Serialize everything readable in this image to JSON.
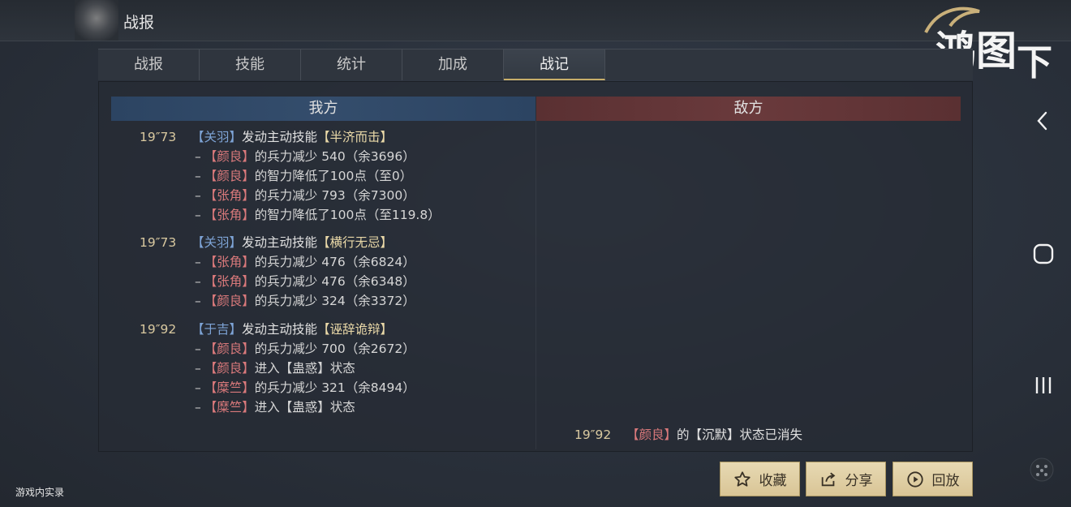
{
  "header": {
    "title": "战报"
  },
  "logo": {
    "text": "鸿图之下"
  },
  "tabs": [
    {
      "label": "战报"
    },
    {
      "label": "技能"
    },
    {
      "label": "统计"
    },
    {
      "label": "加成"
    },
    {
      "label": "战记"
    }
  ],
  "sides": {
    "ours": "我方",
    "enemy": "敌方"
  },
  "log": [
    {
      "time": "19″73",
      "actor": "【关羽】",
      "action": "发动主动技能",
      "skill": "【半济而击】",
      "effects": [
        {
          "target": "【颜良】",
          "text": "的兵力减少 540（余3696）"
        },
        {
          "target": "【颜良】",
          "text": "的智力降低了100点（至0）"
        },
        {
          "target": "【张角】",
          "text": "的兵力减少 793（余7300）"
        },
        {
          "target": "【张角】",
          "text": "的智力降低了100点（至119.8）"
        }
      ]
    },
    {
      "time": "19″73",
      "actor": "【关羽】",
      "action": "发动主动技能",
      "skill": "【横行无忌】",
      "effects": [
        {
          "target": "【张角】",
          "text": "的兵力减少 476（余6824）"
        },
        {
          "target": "【张角】",
          "text": "的兵力减少 476（余6348）"
        },
        {
          "target": "【颜良】",
          "text": "的兵力减少 324（余3372）"
        }
      ]
    },
    {
      "time": "19″92",
      "actor": "【于吉】",
      "action": "发动主动技能",
      "skill": "【诬辞诡辩】",
      "effects": [
        {
          "target": "【颜良】",
          "text": "的兵力减少 700（余2672）"
        },
        {
          "target": "【颜良】",
          "text": "进入【蛊惑】状态"
        },
        {
          "target": "【糜竺】",
          "text": "的兵力减少 321（余8494）"
        },
        {
          "target": "【糜竺】",
          "text": "进入【蛊惑】状态"
        }
      ]
    }
  ],
  "enemy_log": {
    "time": "19″92",
    "actor": "【颜良】",
    "text": "的【沉默】状态已消失"
  },
  "buttons": {
    "favorite": "收藏",
    "share": "分享",
    "replay": "回放"
  },
  "watermark": "游戏内实录",
  "dash": "–"
}
